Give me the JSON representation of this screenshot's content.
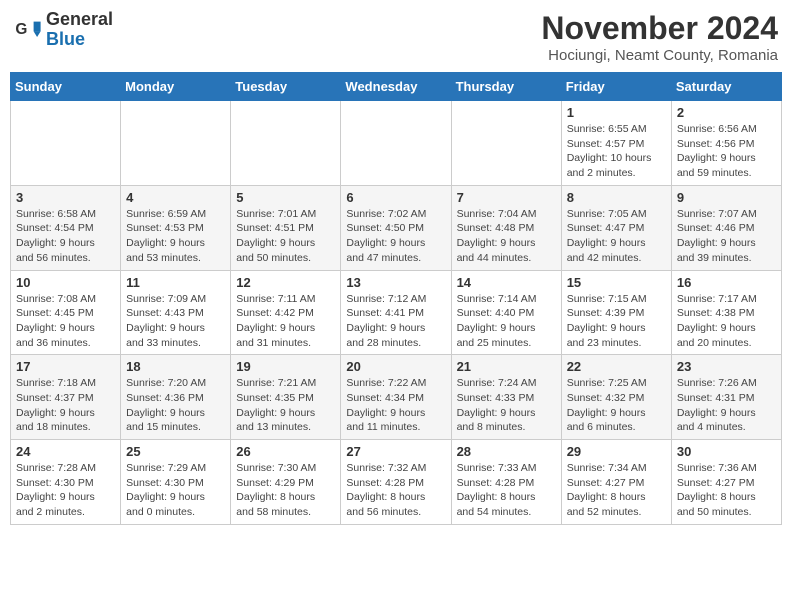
{
  "header": {
    "logo_general": "General",
    "logo_blue": "Blue",
    "month_title": "November 2024",
    "location": "Hociungi, Neamt County, Romania"
  },
  "weekdays": [
    "Sunday",
    "Monday",
    "Tuesday",
    "Wednesday",
    "Thursday",
    "Friday",
    "Saturday"
  ],
  "weeks": [
    [
      {
        "day": "",
        "info": ""
      },
      {
        "day": "",
        "info": ""
      },
      {
        "day": "",
        "info": ""
      },
      {
        "day": "",
        "info": ""
      },
      {
        "day": "",
        "info": ""
      },
      {
        "day": "1",
        "info": "Sunrise: 6:55 AM\nSunset: 4:57 PM\nDaylight: 10 hours and 2 minutes."
      },
      {
        "day": "2",
        "info": "Sunrise: 6:56 AM\nSunset: 4:56 PM\nDaylight: 9 hours and 59 minutes."
      }
    ],
    [
      {
        "day": "3",
        "info": "Sunrise: 6:58 AM\nSunset: 4:54 PM\nDaylight: 9 hours and 56 minutes."
      },
      {
        "day": "4",
        "info": "Sunrise: 6:59 AM\nSunset: 4:53 PM\nDaylight: 9 hours and 53 minutes."
      },
      {
        "day": "5",
        "info": "Sunrise: 7:01 AM\nSunset: 4:51 PM\nDaylight: 9 hours and 50 minutes."
      },
      {
        "day": "6",
        "info": "Sunrise: 7:02 AM\nSunset: 4:50 PM\nDaylight: 9 hours and 47 minutes."
      },
      {
        "day": "7",
        "info": "Sunrise: 7:04 AM\nSunset: 4:48 PM\nDaylight: 9 hours and 44 minutes."
      },
      {
        "day": "8",
        "info": "Sunrise: 7:05 AM\nSunset: 4:47 PM\nDaylight: 9 hours and 42 minutes."
      },
      {
        "day": "9",
        "info": "Sunrise: 7:07 AM\nSunset: 4:46 PM\nDaylight: 9 hours and 39 minutes."
      }
    ],
    [
      {
        "day": "10",
        "info": "Sunrise: 7:08 AM\nSunset: 4:45 PM\nDaylight: 9 hours and 36 minutes."
      },
      {
        "day": "11",
        "info": "Sunrise: 7:09 AM\nSunset: 4:43 PM\nDaylight: 9 hours and 33 minutes."
      },
      {
        "day": "12",
        "info": "Sunrise: 7:11 AM\nSunset: 4:42 PM\nDaylight: 9 hours and 31 minutes."
      },
      {
        "day": "13",
        "info": "Sunrise: 7:12 AM\nSunset: 4:41 PM\nDaylight: 9 hours and 28 minutes."
      },
      {
        "day": "14",
        "info": "Sunrise: 7:14 AM\nSunset: 4:40 PM\nDaylight: 9 hours and 25 minutes."
      },
      {
        "day": "15",
        "info": "Sunrise: 7:15 AM\nSunset: 4:39 PM\nDaylight: 9 hours and 23 minutes."
      },
      {
        "day": "16",
        "info": "Sunrise: 7:17 AM\nSunset: 4:38 PM\nDaylight: 9 hours and 20 minutes."
      }
    ],
    [
      {
        "day": "17",
        "info": "Sunrise: 7:18 AM\nSunset: 4:37 PM\nDaylight: 9 hours and 18 minutes."
      },
      {
        "day": "18",
        "info": "Sunrise: 7:20 AM\nSunset: 4:36 PM\nDaylight: 9 hours and 15 minutes."
      },
      {
        "day": "19",
        "info": "Sunrise: 7:21 AM\nSunset: 4:35 PM\nDaylight: 9 hours and 13 minutes."
      },
      {
        "day": "20",
        "info": "Sunrise: 7:22 AM\nSunset: 4:34 PM\nDaylight: 9 hours and 11 minutes."
      },
      {
        "day": "21",
        "info": "Sunrise: 7:24 AM\nSunset: 4:33 PM\nDaylight: 9 hours and 8 minutes."
      },
      {
        "day": "22",
        "info": "Sunrise: 7:25 AM\nSunset: 4:32 PM\nDaylight: 9 hours and 6 minutes."
      },
      {
        "day": "23",
        "info": "Sunrise: 7:26 AM\nSunset: 4:31 PM\nDaylight: 9 hours and 4 minutes."
      }
    ],
    [
      {
        "day": "24",
        "info": "Sunrise: 7:28 AM\nSunset: 4:30 PM\nDaylight: 9 hours and 2 minutes."
      },
      {
        "day": "25",
        "info": "Sunrise: 7:29 AM\nSunset: 4:30 PM\nDaylight: 9 hours and 0 minutes."
      },
      {
        "day": "26",
        "info": "Sunrise: 7:30 AM\nSunset: 4:29 PM\nDaylight: 8 hours and 58 minutes."
      },
      {
        "day": "27",
        "info": "Sunrise: 7:32 AM\nSunset: 4:28 PM\nDaylight: 8 hours and 56 minutes."
      },
      {
        "day": "28",
        "info": "Sunrise: 7:33 AM\nSunset: 4:28 PM\nDaylight: 8 hours and 54 minutes."
      },
      {
        "day": "29",
        "info": "Sunrise: 7:34 AM\nSunset: 4:27 PM\nDaylight: 8 hours and 52 minutes."
      },
      {
        "day": "30",
        "info": "Sunrise: 7:36 AM\nSunset: 4:27 PM\nDaylight: 8 hours and 50 minutes."
      }
    ]
  ]
}
